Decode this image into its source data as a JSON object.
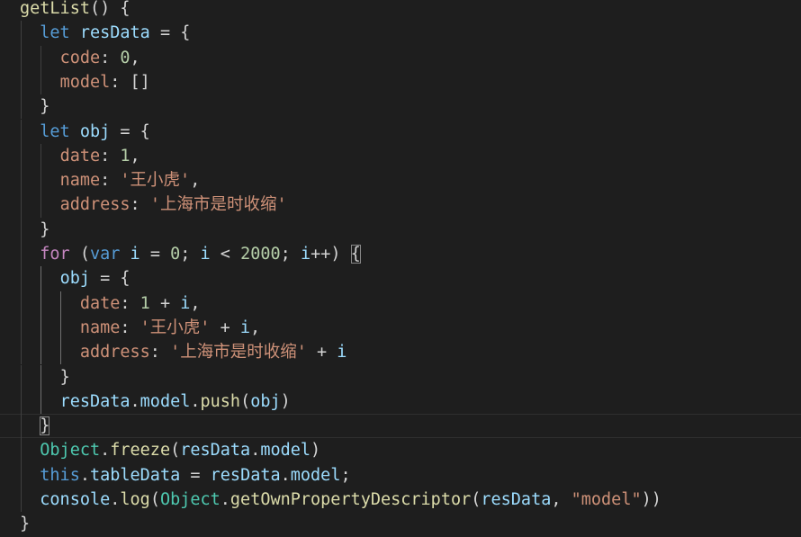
{
  "editor": {
    "language": "javascript",
    "theme": "dark",
    "background": "#1e1e1e",
    "colors": {
      "keyword": "#569cd6",
      "control": "#c586c0",
      "variable": "#9cdcfe",
      "function": "#dcdcaa",
      "class": "#4ec9b0",
      "string": "#ce9178",
      "number": "#b5cea8"
    },
    "lines": [
      {
        "indent": 0,
        "tokens": [
          [
            "fn",
            "getList"
          ],
          [
            "pun",
            "() {"
          ]
        ]
      },
      {
        "indent": 1,
        "tokens": [
          [
            "kw",
            "let"
          ],
          [
            "pun",
            " "
          ],
          [
            "var",
            "resData"
          ],
          [
            "pun",
            " = {"
          ]
        ]
      },
      {
        "indent": 2,
        "tokens": [
          [
            "prop",
            "code"
          ],
          [
            "pun",
            ": "
          ],
          [
            "num",
            "0"
          ],
          [
            "pun",
            ","
          ]
        ]
      },
      {
        "indent": 2,
        "tokens": [
          [
            "prop",
            "model"
          ],
          [
            "pun",
            ": []"
          ]
        ]
      },
      {
        "indent": 1,
        "tokens": [
          [
            "pun",
            "}"
          ]
        ]
      },
      {
        "indent": 1,
        "tokens": [
          [
            "kw",
            "let"
          ],
          [
            "pun",
            " "
          ],
          [
            "var",
            "obj"
          ],
          [
            "pun",
            " = {"
          ]
        ]
      },
      {
        "indent": 2,
        "tokens": [
          [
            "prop",
            "date"
          ],
          [
            "pun",
            ": "
          ],
          [
            "num",
            "1"
          ],
          [
            "pun",
            ","
          ]
        ]
      },
      {
        "indent": 2,
        "tokens": [
          [
            "prop",
            "name"
          ],
          [
            "pun",
            ": "
          ],
          [
            "str",
            "'王小虎'"
          ],
          [
            "pun",
            ","
          ]
        ]
      },
      {
        "indent": 2,
        "tokens": [
          [
            "prop",
            "address"
          ],
          [
            "pun",
            ": "
          ],
          [
            "str",
            "'上海市是时收缩'"
          ]
        ]
      },
      {
        "indent": 1,
        "tokens": [
          [
            "pun",
            "}"
          ]
        ]
      },
      {
        "indent": 1,
        "tokens": [
          [
            "ctl",
            "for"
          ],
          [
            "pun",
            " ("
          ],
          [
            "kw",
            "var"
          ],
          [
            "pun",
            " "
          ],
          [
            "var",
            "i"
          ],
          [
            "pun",
            " = "
          ],
          [
            "num",
            "0"
          ],
          [
            "pun",
            "; "
          ],
          [
            "var",
            "i"
          ],
          [
            "pun",
            " < "
          ],
          [
            "num",
            "2000"
          ],
          [
            "pun",
            "; "
          ],
          [
            "var",
            "i"
          ],
          [
            "pun",
            "++) "
          ],
          [
            "brk",
            "{"
          ]
        ]
      },
      {
        "indent": 2,
        "tokens": [
          [
            "var",
            "obj"
          ],
          [
            "pun",
            " = {"
          ]
        ]
      },
      {
        "indent": 3,
        "tokens": [
          [
            "prop",
            "date"
          ],
          [
            "pun",
            ": "
          ],
          [
            "num",
            "1"
          ],
          [
            "pun",
            " + "
          ],
          [
            "var",
            "i"
          ],
          [
            "pun",
            ","
          ]
        ]
      },
      {
        "indent": 3,
        "tokens": [
          [
            "prop",
            "name"
          ],
          [
            "pun",
            ": "
          ],
          [
            "str",
            "'王小虎'"
          ],
          [
            "pun",
            " + "
          ],
          [
            "var",
            "i"
          ],
          [
            "pun",
            ","
          ]
        ]
      },
      {
        "indent": 3,
        "tokens": [
          [
            "prop",
            "address"
          ],
          [
            "pun",
            ": "
          ],
          [
            "str",
            "'上海市是时收缩'"
          ],
          [
            "pun",
            " + "
          ],
          [
            "var",
            "i"
          ]
        ]
      },
      {
        "indent": 2,
        "tokens": [
          [
            "pun",
            "}"
          ]
        ]
      },
      {
        "indent": 2,
        "tokens": [
          [
            "var",
            "resData"
          ],
          [
            "pun",
            "."
          ],
          [
            "var",
            "model"
          ],
          [
            "pun",
            "."
          ],
          [
            "fn",
            "push"
          ],
          [
            "pun",
            "("
          ],
          [
            "var",
            "obj"
          ],
          [
            "pun",
            ")"
          ]
        ]
      },
      {
        "indent": 1,
        "current": true,
        "tokens": [
          [
            "brk",
            "}"
          ]
        ]
      },
      {
        "indent": 1,
        "tokens": [
          [
            "cls",
            "Object"
          ],
          [
            "pun",
            "."
          ],
          [
            "fn",
            "freeze"
          ],
          [
            "pun",
            "("
          ],
          [
            "var",
            "resData"
          ],
          [
            "pun",
            "."
          ],
          [
            "var",
            "model"
          ],
          [
            "pun",
            ")"
          ]
        ]
      },
      {
        "indent": 1,
        "tokens": [
          [
            "kw",
            "this"
          ],
          [
            "pun",
            "."
          ],
          [
            "var",
            "tableData"
          ],
          [
            "pun",
            " = "
          ],
          [
            "var",
            "resData"
          ],
          [
            "pun",
            "."
          ],
          [
            "var",
            "model"
          ],
          [
            "pun",
            ";"
          ]
        ]
      },
      {
        "indent": 1,
        "tokens": [
          [
            "var",
            "console"
          ],
          [
            "pun",
            "."
          ],
          [
            "fn",
            "log"
          ],
          [
            "pun",
            "("
          ],
          [
            "cls",
            "Object"
          ],
          [
            "pun",
            "."
          ],
          [
            "fn",
            "getOwnPropertyDescriptor"
          ],
          [
            "pun",
            "("
          ],
          [
            "var",
            "resData"
          ],
          [
            "pun",
            ", "
          ],
          [
            "str",
            "\"model\""
          ],
          [
            "pun",
            "))"
          ]
        ]
      },
      {
        "indent": 0,
        "tokens": [
          [
            "pun",
            "}"
          ]
        ]
      }
    ]
  }
}
